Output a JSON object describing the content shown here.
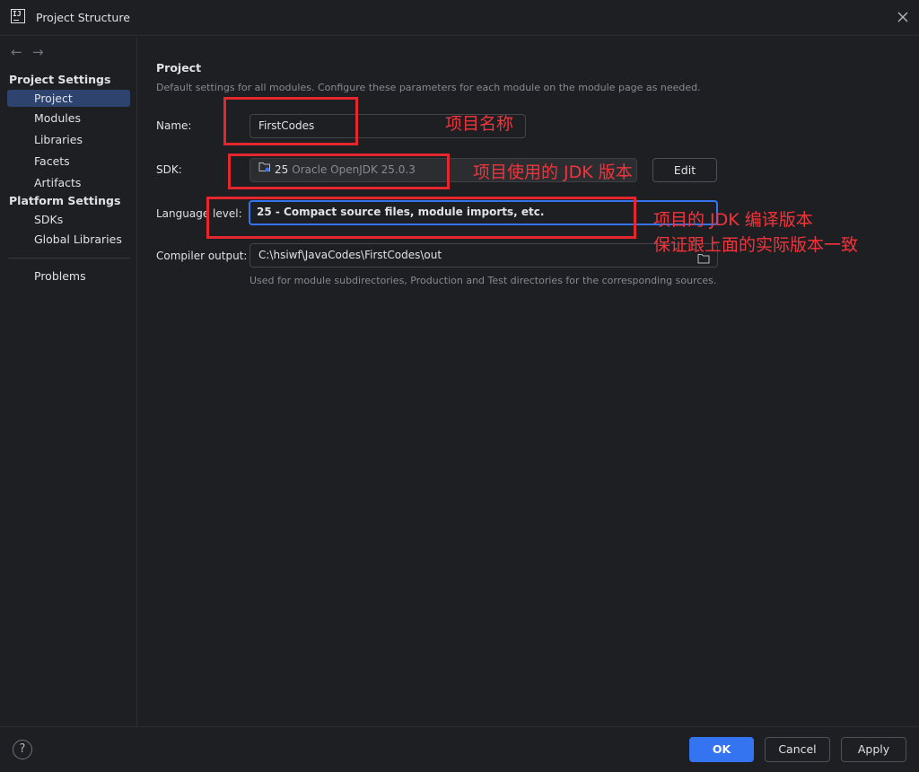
{
  "window": {
    "title": "Project Structure",
    "app_icon_text": "IJ",
    "close_icon": "close-icon"
  },
  "sidebar": {
    "back_arrow": "←",
    "forward_arrow": "→",
    "project_settings_header": "Project Settings",
    "project_settings_items": [
      {
        "label": "Project",
        "selected": true
      },
      {
        "label": "Modules",
        "selected": false
      },
      {
        "label": "Libraries",
        "selected": false
      },
      {
        "label": "Facets",
        "selected": false
      },
      {
        "label": "Artifacts",
        "selected": false
      }
    ],
    "platform_settings_header": "Platform Settings",
    "platform_settings_items": [
      {
        "label": "SDKs"
      },
      {
        "label": "Global Libraries"
      }
    ],
    "problems_label": "Problems"
  },
  "main": {
    "title": "Project",
    "description": "Default settings for all modules. Configure these parameters for each module on the module page as needed.",
    "name": {
      "label": "Name:",
      "value": "FirstCodes"
    },
    "sdk": {
      "label": "SDK:",
      "version": "25",
      "name": "Oracle OpenJDK 25.0.3",
      "edit_label": "Edit",
      "icon": "sdk-folder-icon"
    },
    "language_level": {
      "label": "Language level:",
      "value": "25 - Compact source files, module imports, etc."
    },
    "compiler_output": {
      "label": "Compiler output:",
      "value": "C:\\hsiwf\\JavaCodes\\FirstCodes\\out",
      "icon": "folder-icon",
      "hint": "Used for module subdirectories, Production and Test directories for the corresponding sources."
    }
  },
  "annotations": {
    "name_note": "项目名称",
    "sdk_note": "项目使用的 JDK 版本",
    "language_note_line1": "项目的 JDK 编译版本",
    "language_note_line2": "保证跟上面的实际版本一致",
    "color": "#e4262d"
  },
  "footer": {
    "help": "?",
    "ok_label": "OK",
    "cancel_label": "Cancel",
    "apply_label": "Apply"
  },
  "colors": {
    "background": "#1e1f22",
    "selection": "#2e436e",
    "accent": "#3574f0"
  }
}
